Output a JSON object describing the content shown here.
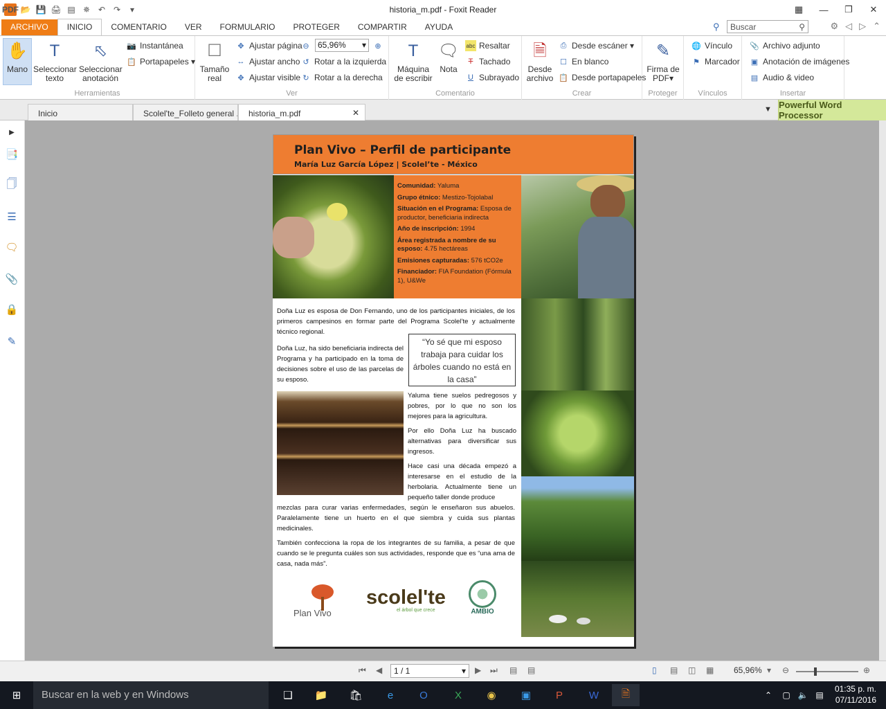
{
  "window": {
    "title": "historia_m.pdf - Foxit Reader"
  },
  "menu": {
    "tabs": [
      "ARCHIVO",
      "INICIO",
      "COMENTARIO",
      "VER",
      "FORMULARIO",
      "PROTEGER",
      "COMPARTIR",
      "AYUDA"
    ],
    "search_placeholder": "Buscar"
  },
  "ribbon": {
    "herramientas": {
      "label": "Herramientas",
      "mano": "Mano",
      "sel_texto": "Seleccionar texto",
      "sel_anot": "Seleccionar anotación",
      "instantanea": "Instantánea",
      "portapapeles": "Portapapeles"
    },
    "ver": {
      "label": "Ver",
      "tamano_real": "Tamaño real",
      "ajustar_pagina": "Ajustar página",
      "ajustar_ancho": "Ajustar ancho",
      "ajustar_visible": "Ajustar visible",
      "zoom": "65,96%",
      "rot_izq": "Rotar a la izquierda",
      "rot_der": "Rotar a la derecha"
    },
    "comentario": {
      "label": "Comentario",
      "maquina": "Máquina de escribir",
      "nota": "Nota",
      "resaltar": "Resaltar",
      "tachado": "Tachado",
      "subrayado": "Subrayado"
    },
    "crear": {
      "label": "Crear",
      "desde_archivo": "Desde archivo",
      "desde_escaner": "Desde escáner",
      "en_blanco": "En blanco",
      "desde_portapapeles": "Desde portapapeles"
    },
    "proteger": {
      "label": "Proteger",
      "firma": "Firma de PDF"
    },
    "vinculos": {
      "label": "Vínculos",
      "vinculo": "Vínculo",
      "marcador": "Marcador"
    },
    "insertar": {
      "label": "Insertar",
      "archivo_adjunto": "Archivo adjunto",
      "anotacion_imagenes": "Anotación de imágenes",
      "audio_video": "Audio & video"
    }
  },
  "doc_tabs": [
    "Inicio",
    "Scolel'te_Folleto general ...",
    "historia_m.pdf"
  ],
  "ad": "Powerful Word Processor",
  "pdf": {
    "title": "Plan Vivo – Perfil de participante",
    "subtitle": "María Luz García López | Scolel’te - México",
    "info": [
      {
        "k": "Comunidad:",
        "v": " Yaluma"
      },
      {
        "k": "Grupo étnico:",
        "v": " Mestizo-Tojolabal"
      },
      {
        "k": "Situación en el Programa:",
        "v": " Esposa de productor, beneficiaria indirecta"
      },
      {
        "k": "Año de inscripción:",
        "v": " 1994"
      },
      {
        "k": "Área registrada a nombre de su esposo:",
        "v": " 4.75 hectáreas"
      },
      {
        "k": "Emisiones capturadas:",
        "v": " 576 tCO2e"
      },
      {
        "k": "Financiador:",
        "v": " FIA Foundation (Fórmula 1), U&We"
      }
    ],
    "p1": "Doña Luz es esposa de Don Fernando, uno de los participantes iniciales, de los primeros campesinos en formar parte del Programa Scolel’te y actualmente técnico regional.",
    "p2": "Doña Luz, ha sido beneficiaria indirecta del Programa y ha participado en la toma de decisiones sobre el uso de las parcelas de su esposo.",
    "quote": "“Yo sé que mi esposo trabaja para cuidar los árboles cuando no está en la casa”",
    "p3": "Yaluma tiene suelos pedregosos y pobres, por lo que no son los mejores para la agricultura.",
    "p4": "Por ello Doña Luz ha buscado alternativas para diversificar sus ingresos.",
    "p5a": "Hace casi una década empezó a interesarse en el estudio de la herbolaria. Actualmente tiene un pequeño taller donde produce",
    "p5b": "mezclas para curar varias enfermedades, según le enseñaron sus abuelos. Paralelamente  tiene un huerto en el que siembra y cuida sus plantas medicinales.",
    "p6": "También confecciona la ropa de los integrantes de su familia, a pesar de que cuando se le pregunta cuáles son sus actividades, responde que es “una ama de casa, nada más”.",
    "logos": {
      "planvivo": "Plan Vivo",
      "scolelte": "scolel'te",
      "scolelte_tag": "el árbol que crece",
      "ambio": "AMBIO"
    }
  },
  "status": {
    "page": "1 / 1",
    "zoom": "65,96%"
  },
  "taskbar": {
    "search": "Buscar en la web y en Windows",
    "time": "01:35 p. m.",
    "date": "07/11/2016"
  }
}
